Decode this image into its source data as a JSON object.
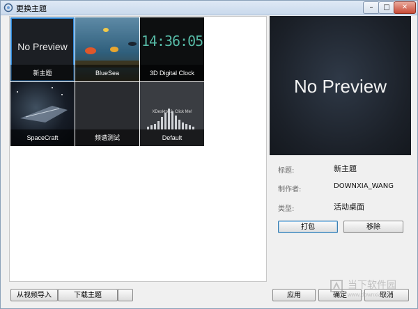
{
  "window": {
    "title": "更换主题",
    "minimize_glyph": "–",
    "maximize_glyph": "□",
    "close_glyph": "✕"
  },
  "themes": [
    {
      "name": "新主题",
      "thumb_text": "No Preview",
      "selected": true
    },
    {
      "name": "BlueSea",
      "thumb_text": ""
    },
    {
      "name": "3D Digital Clock",
      "thumb_text": "14:36:05"
    },
    {
      "name": "SpaceCraft",
      "thumb_text": ""
    },
    {
      "name": "频谱测试",
      "thumb_text": ""
    },
    {
      "name": "Default",
      "thumb_text": "XDesktop2, Click Me!"
    }
  ],
  "preview": {
    "text": "No Preview"
  },
  "details": {
    "title_label": "标题:",
    "title_value": "新主题",
    "author_label": "制作者:",
    "author_value": "DOWNXIA_WANG",
    "type_label": "类型:",
    "type_value": "活动桌面"
  },
  "buttons": {
    "pack": "打包",
    "remove": "移除",
    "import_video": "从视频导入",
    "download_theme": "下载主题",
    "extra": "",
    "apply": "应用",
    "ok": "确定",
    "cancel": "取消"
  },
  "watermark": {
    "text": "当下软件园",
    "url": "www.downxia.com"
  },
  "colors": {
    "selection": "#2f86d4",
    "clock_digits": "#56b9a5"
  }
}
